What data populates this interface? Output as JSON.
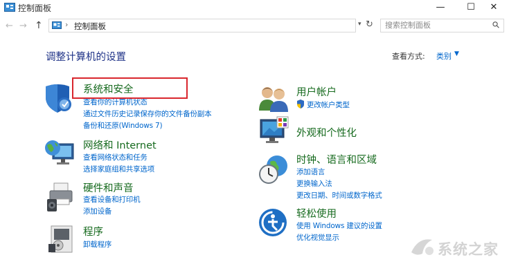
{
  "window": {
    "title": "控制面板",
    "minimize_glyph": "—",
    "maximize_glyph": "☐",
    "close_glyph": "✕"
  },
  "address_bar": {
    "path": "控制面板",
    "search_placeholder": "搜索控制面板"
  },
  "page": {
    "heading": "调整计算机的设置",
    "view_by_label": "查看方式:",
    "view_by_value": "类别"
  },
  "categories_left": [
    {
      "icon": "shield-icon",
      "title": "系统和安全",
      "links": [
        "查看你的计算机状态",
        "通过文件历史记录保存你的文件备份副本",
        "备份和还原(Windows 7)"
      ]
    },
    {
      "icon": "network-globe-icon",
      "title": "网络和 Internet",
      "links": [
        "查看网络状态和任务",
        "选择家庭组和共享选项"
      ]
    },
    {
      "icon": "printer-speaker-icon",
      "title": "硬件和声音",
      "links": [
        "查看设备和打印机",
        "添加设备"
      ]
    },
    {
      "icon": "programs-icon",
      "title": "程序",
      "links": [
        "卸载程序"
      ]
    }
  ],
  "categories_right": [
    {
      "icon": "users-icon",
      "title": "用户帐户",
      "links": [
        "更改帐户类型"
      ]
    },
    {
      "icon": "monitor-palette-icon",
      "title": "外观和个性化",
      "links": []
    },
    {
      "icon": "clock-globe-icon",
      "title": "时钟、语言和区域",
      "links": [
        "添加语言",
        "更换输入法",
        "更改日期、时间或数字格式"
      ]
    },
    {
      "icon": "ease-of-access-icon",
      "title": "轻松使用",
      "links": [
        "使用 Windows 建议的设置",
        "优化视觉显示"
      ]
    }
  ],
  "watermark": {
    "text": "系统之家"
  },
  "colors": {
    "heading": "#1e3287",
    "category": "#166a1e",
    "link": "#0066cc",
    "highlight": "#d9262d"
  }
}
